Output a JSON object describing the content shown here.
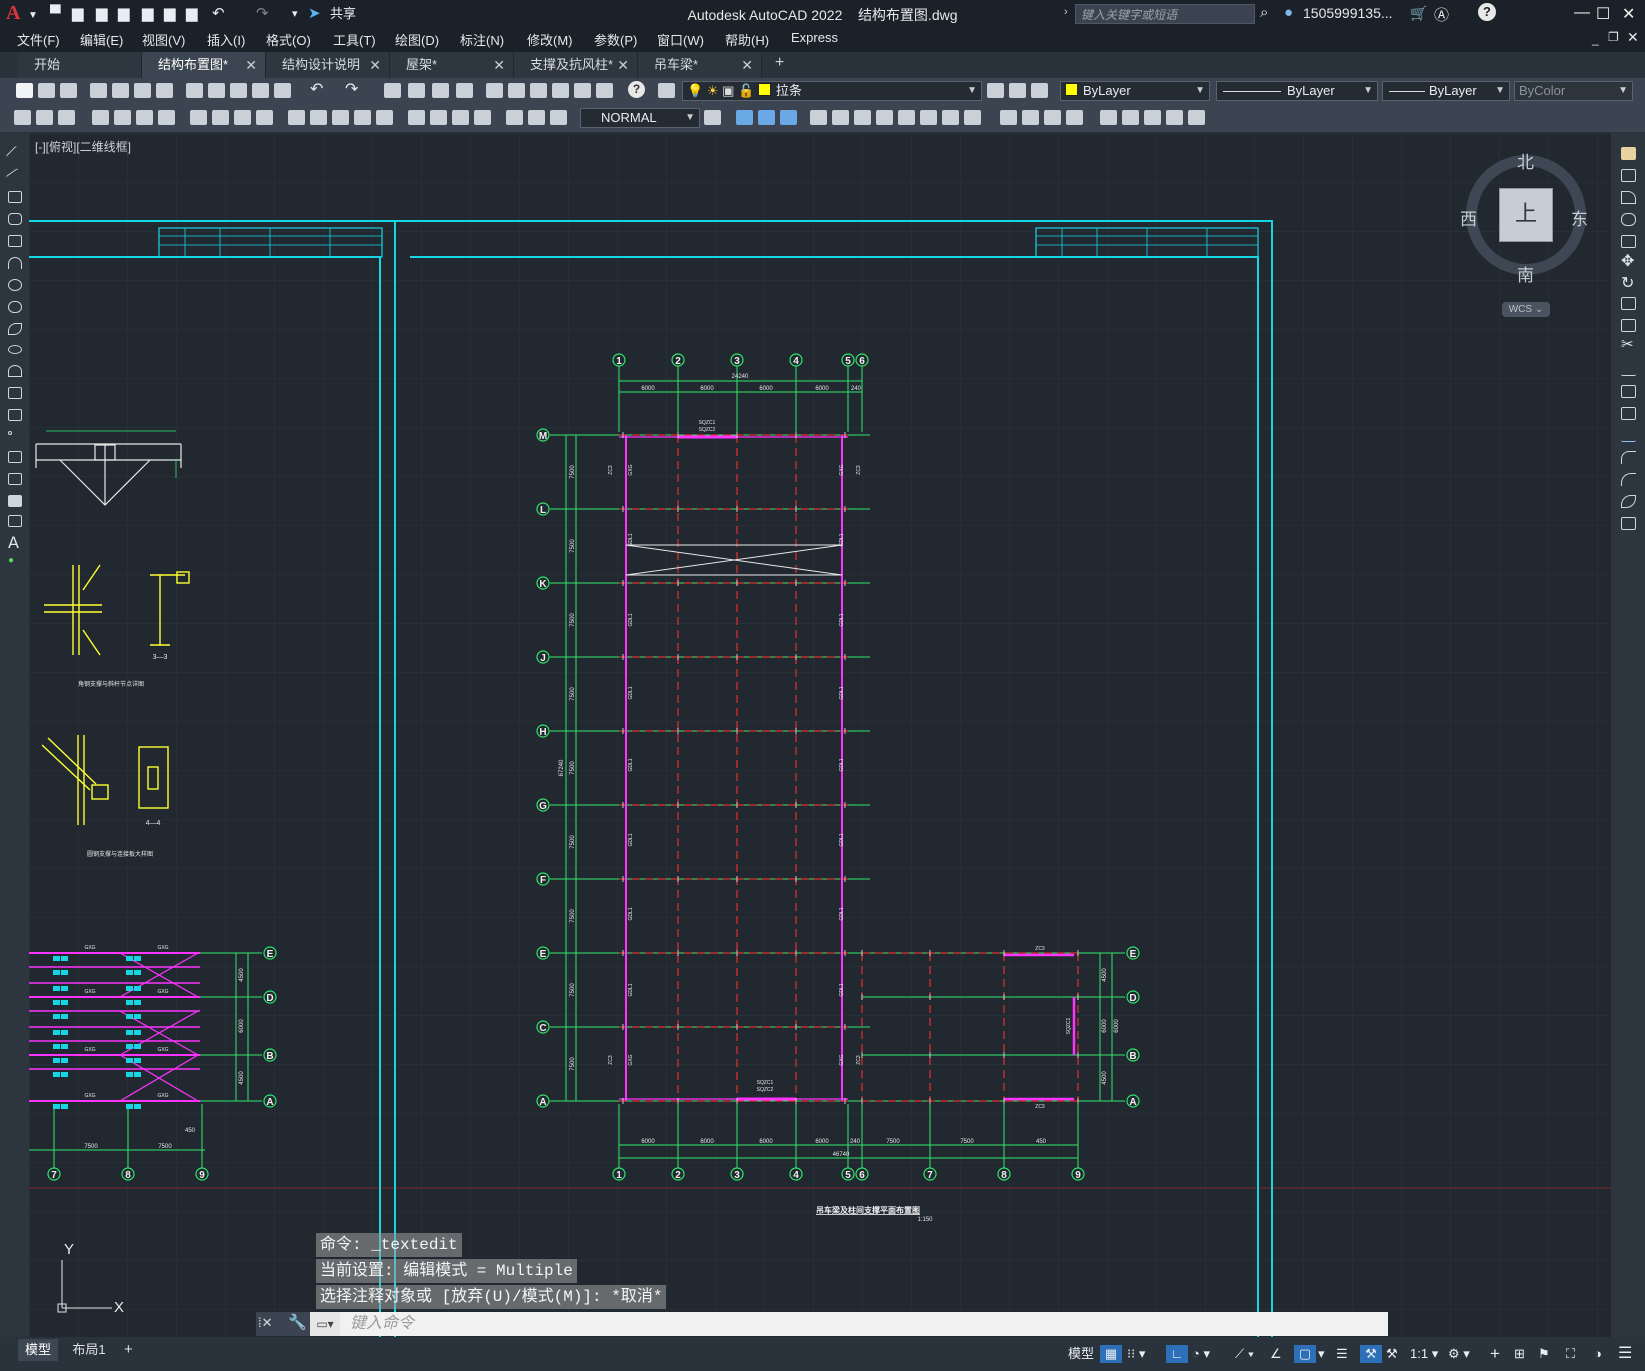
{
  "app": {
    "logo": "A",
    "title": "Autodesk AutoCAD 2022",
    "file": "结构布置图.dwg",
    "share": "共享",
    "search_placeholder": "键入关键字或短语",
    "user": "1505999135...",
    "help": "?"
  },
  "menu": [
    "文件(F)",
    "编辑(E)",
    "视图(V)",
    "插入(I)",
    "格式(O)",
    "工具(T)",
    "绘图(D)",
    "标注(N)",
    "修改(M)",
    "参数(P)",
    "窗口(W)",
    "帮助(H)",
    "Express"
  ],
  "tabs": [
    {
      "label": "开始",
      "close": false,
      "active": false
    },
    {
      "label": "结构布置图*",
      "close": true,
      "active": true
    },
    {
      "label": "结构设计说明",
      "close": true,
      "active": false
    },
    {
      "label": "屋架*",
      "close": true,
      "active": false
    },
    {
      "label": "支撑及抗风柱*",
      "close": true,
      "active": false
    },
    {
      "label": "吊车梁*",
      "close": true,
      "active": false
    }
  ],
  "toolbar": {
    "layer": "拉条",
    "color": "ByLayer",
    "linetype": "ByLayer",
    "lineweight": "ByLayer",
    "plotstyle": "ByColor",
    "dimstyle": "NORMAL",
    "layer_color": "#ffff00"
  },
  "viewport_label": "[-][俯视][二维线框]",
  "viewcube": {
    "north": "北",
    "south": "南",
    "east": "东",
    "west": "西",
    "face": "上",
    "wcs": "WCS"
  },
  "drawing": {
    "main_title": "吊车梁及柱间支撑平面布置图",
    "main_scale": "1:150",
    "col_labels_top": [
      "1",
      "2",
      "3",
      "4",
      "5",
      "6"
    ],
    "col_labels_bottom": [
      "1",
      "2",
      "3",
      "4",
      "5",
      "6",
      "7",
      "8",
      "9"
    ],
    "row_labels": [
      "M",
      "L",
      "K",
      "J",
      "H",
      "G",
      "F",
      "E",
      "C",
      "A"
    ],
    "right_row_labels": [
      "E",
      "D",
      "B",
      "A"
    ],
    "left_row_labels": [
      "E",
      "D",
      "B",
      "A"
    ],
    "left_col_labels": [
      "7",
      "8",
      "9"
    ],
    "top_dims": [
      "6000",
      "6000",
      "6000",
      "6000",
      "240"
    ],
    "top_total": "24240",
    "bottom_dims": [
      "6000",
      "6000",
      "6000",
      "6000",
      "240",
      "7500",
      "7500",
      "450"
    ],
    "bottom_total": "46740",
    "left_bottom_dims": [
      "7500",
      "7500",
      "450"
    ],
    "left_total": "67240",
    "detail1_title": "角钢支撑与斜杆节点详图",
    "detail2_title": "圆钢支撑与连接板大样图",
    "section_33": "3—3",
    "section_44": "4—4",
    "beam_labels": [
      "SQZC1",
      "SQZC2",
      "ZC3",
      "GDL1",
      "GDL2",
      "GXG"
    ],
    "bay_dim": "7500",
    "span_dim": "6000",
    "small_dim": "4500"
  },
  "command": {
    "lines": [
      "命令:  _textedit",
      "当前设置: 编辑模式 = Multiple",
      "选择注释对象或 [放弃(U)/模式(M)]: *取消*"
    ],
    "placeholder": "键入命令"
  },
  "status": {
    "model_tab": "模型",
    "layout_tab": "布局1",
    "model": "模型",
    "scale": "1:1"
  }
}
